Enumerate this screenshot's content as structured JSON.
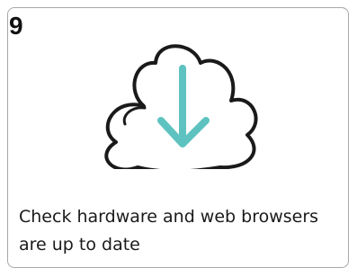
{
  "card": {
    "step_number": "9",
    "caption": "Check hardware and web browsers are up to date",
    "icon": "cloud-download-icon",
    "colors": {
      "outline": "#1a1a1a",
      "arrow": "#5ec3c0",
      "border": "#a8a8a8"
    }
  }
}
